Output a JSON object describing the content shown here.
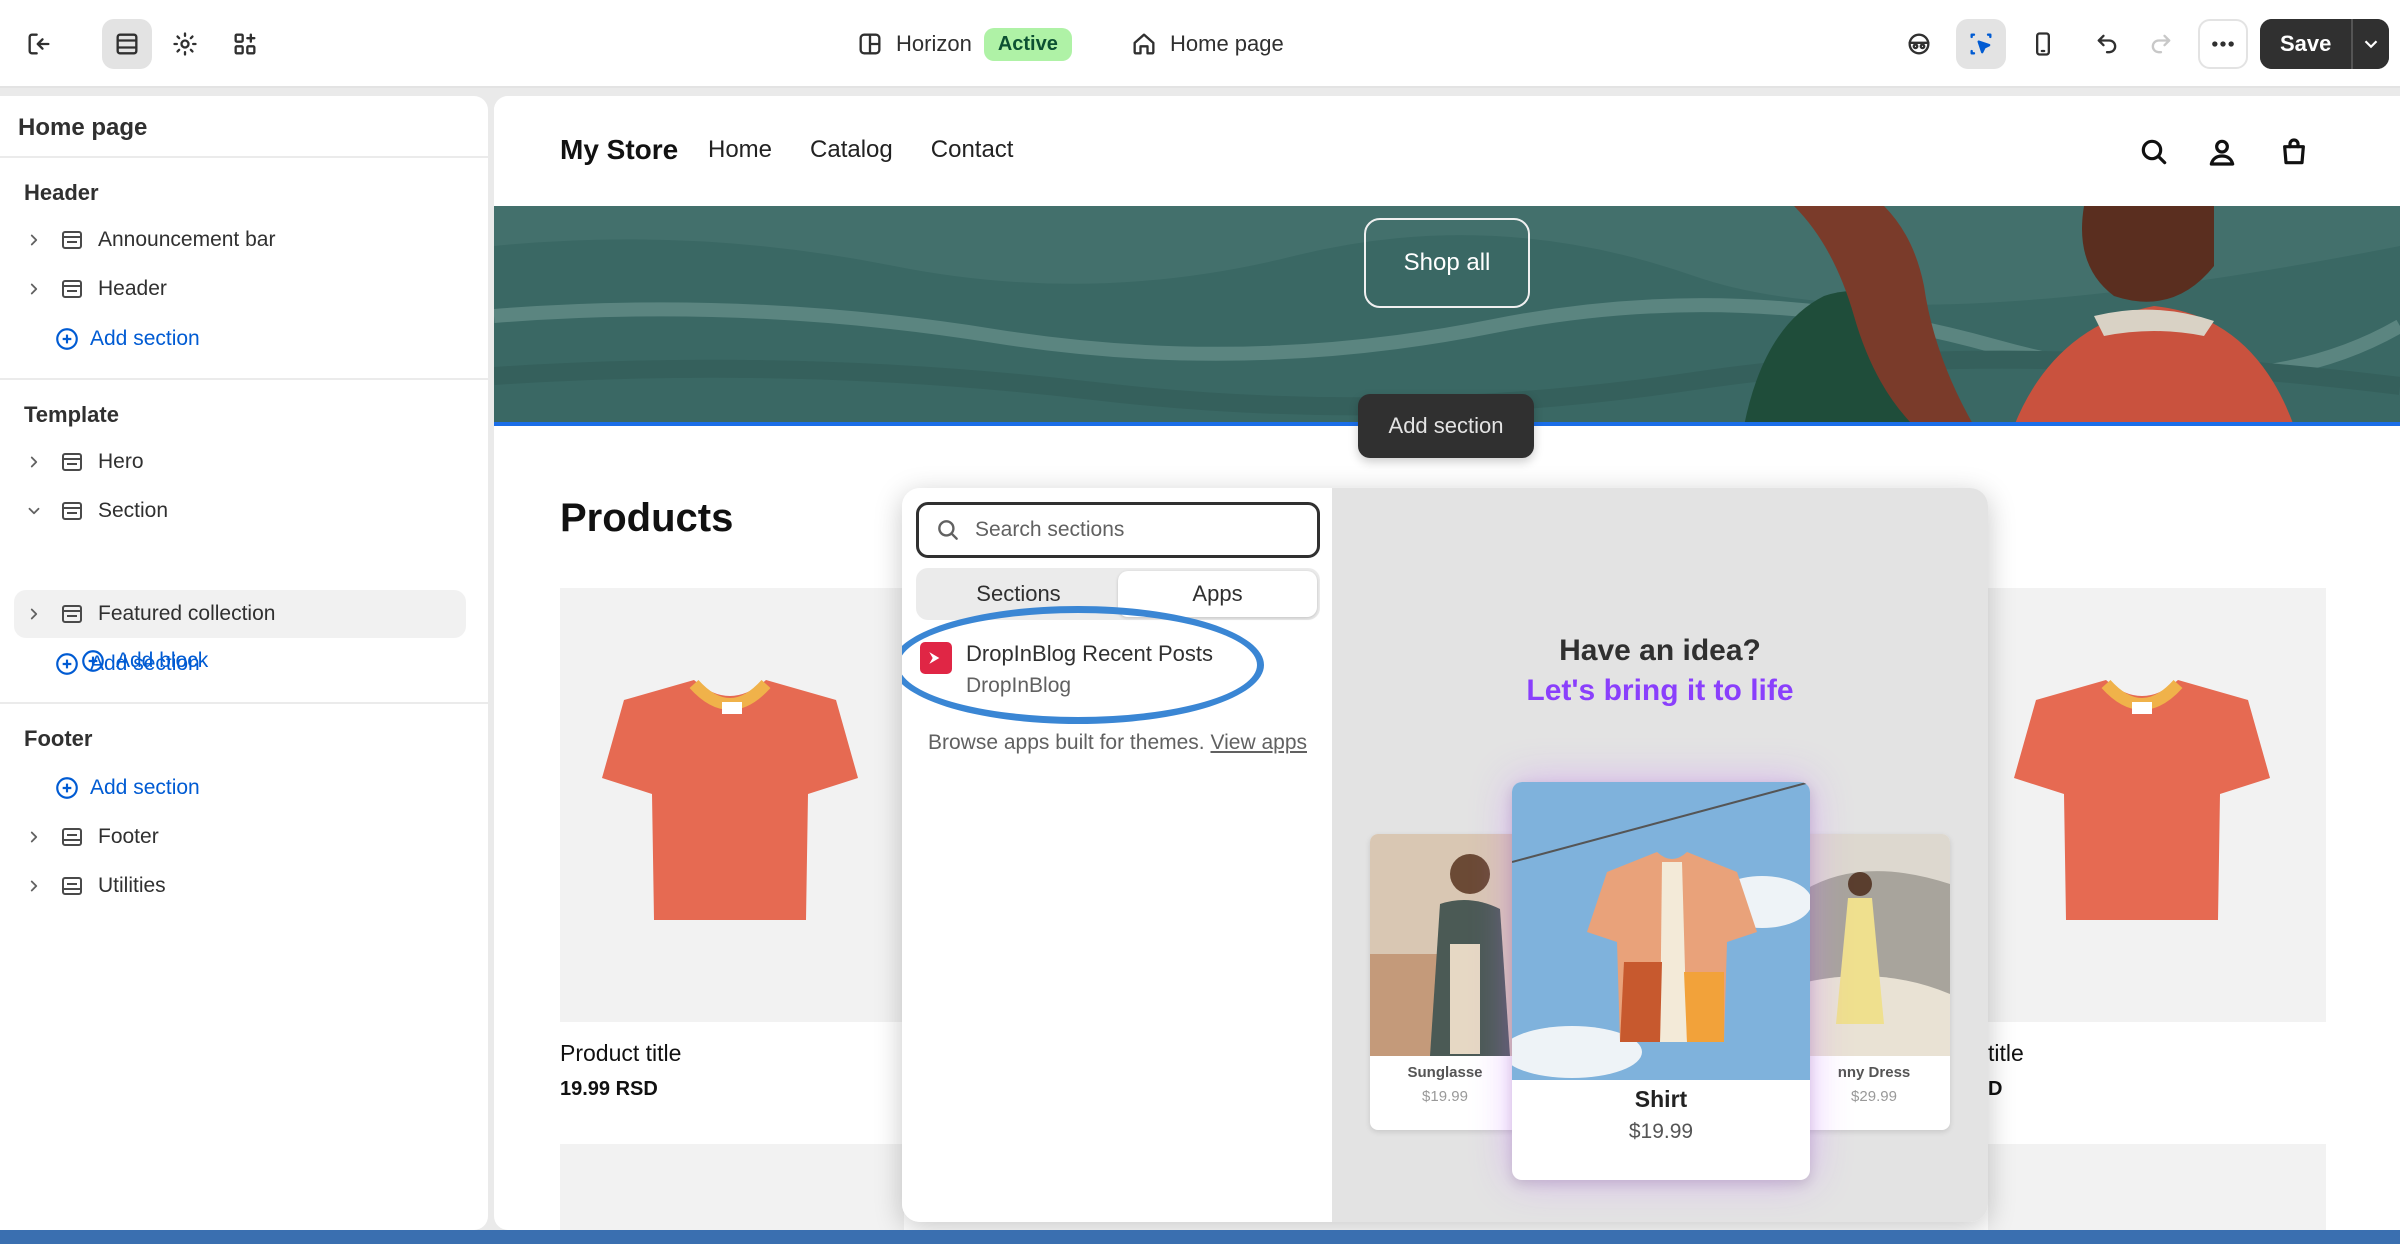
{
  "topbar": {
    "theme_name": "Horizon",
    "theme_status": "Active",
    "page_selector": "Home page",
    "save_label": "Save"
  },
  "sidebar": {
    "title": "Home page",
    "header_group": {
      "label": "Header",
      "items": [
        "Announcement bar",
        "Header"
      ],
      "add_label": "Add section"
    },
    "template_group": {
      "label": "Template",
      "items": [
        "Hero",
        "Section",
        "Featured collection"
      ],
      "add_block_label": "Add block",
      "add_label": "Add section"
    },
    "footer_group": {
      "label": "Footer",
      "add_label": "Add section",
      "items": [
        "Footer",
        "Utilities"
      ]
    }
  },
  "store": {
    "name": "My Store",
    "nav": [
      "Home",
      "Catalog",
      "Contact"
    ],
    "hero_button": "Shop all",
    "add_section_tooltip": "Add section",
    "products_title": "Products",
    "products": [
      {
        "title": "Product title",
        "price": "19.99 RSD"
      },
      {
        "title": "title",
        "price": "D"
      }
    ]
  },
  "picker": {
    "search_placeholder": "Search sections",
    "tabs": [
      "Sections",
      "Apps"
    ],
    "active_tab": "Apps",
    "app": {
      "name": "DropInBlog Recent Posts",
      "vendor": "DropInBlog"
    },
    "browse_text": "Browse apps built for themes.",
    "browse_link": "View apps",
    "promo": {
      "line1": "Have an idea?",
      "line2": "Let's bring it to life",
      "left_card": {
        "label": "Sunglasse",
        "price": "$19.99"
      },
      "main_card": {
        "label": "Shirt",
        "price": "$19.99"
      },
      "right_card": {
        "label": "nny Dress",
        "price": "$29.99"
      }
    }
  },
  "colors": {
    "accent": "#005bd3",
    "active_badge": "#aff2a6",
    "app_logo": "#e02645",
    "promo_purple": "#8a3ffc",
    "highlight_ring": "#3a86d4"
  }
}
